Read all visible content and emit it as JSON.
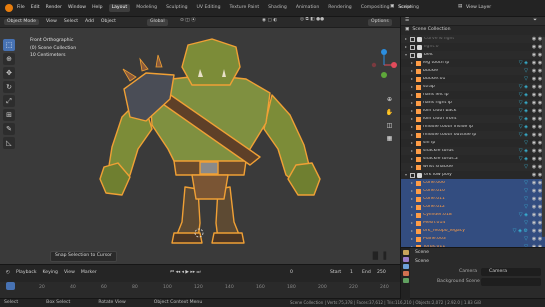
{
  "menu": {
    "items": [
      "File",
      "Edit",
      "Render",
      "Window",
      "Help"
    ],
    "workspaces": [
      "Layout",
      "Modeling",
      "Sculpting",
      "UV Editing",
      "Texture Paint",
      "Shading",
      "Animation",
      "Rendering",
      "Compositing",
      "Scripting"
    ],
    "active_workspace": "Layout",
    "scene_label": "Scene",
    "view_layer_label": "View Layer"
  },
  "viewport": {
    "mode": "Object Mode",
    "menus": [
      "View",
      "Select",
      "Add",
      "Object"
    ],
    "transform_orientation": "Global",
    "options_label": "Options",
    "overlay_lines": [
      "Front Orthographic",
      "(0) Scene Collection",
      "10 Centimeters"
    ],
    "snap_chip": "Snap Selection to Cursor",
    "gizmo_axes": [
      "X",
      "Y",
      "Z"
    ]
  },
  "timeline": {
    "menus": [
      "Playback",
      "Keying",
      "View",
      "Marker"
    ],
    "current_frame": "0",
    "start_label": "Start",
    "start_value": "1",
    "end_label": "End",
    "end_value": "250",
    "ruler_ticks": [
      "0",
      "20",
      "40",
      "60",
      "80",
      "100",
      "120",
      "140",
      "160",
      "180",
      "200",
      "220",
      "240"
    ]
  },
  "statusbar": {
    "select": "Select",
    "box_select": "Box Select",
    "rotate_view": "Rotate View",
    "context_menu": "Object Context Menu",
    "stats": "Scene Collection | Verts:75,378 | Faces:37,612 | Tris:116,210 | Objects:2,072 | 2.92.0 | 1.83 GiB"
  },
  "outliner": {
    "title": "Scene Collection",
    "rows": [
      {
        "name": "Curve & light",
        "level": 1,
        "expand": "▸",
        "type": "collection",
        "dim": true,
        "selected": false,
        "mods": "",
        "eye": "◉",
        "cam": "◉"
      },
      {
        "name": "light.0",
        "level": 1,
        "expand": "▸",
        "type": "collection",
        "dim": true,
        "selected": false,
        "mods": "",
        "eye": "◉",
        "cam": "◉"
      },
      {
        "name": "belt",
        "level": 1,
        "expand": "▾",
        "type": "collection",
        "dim": false,
        "selected": false,
        "mods": "",
        "eye": "◉",
        "cam": "◉"
      },
      {
        "name": "leg tooth lp",
        "level": 2,
        "expand": "▸",
        "type": "mesh",
        "dim": false,
        "selected": false,
        "mods": "▽ ◈",
        "eye": "◉",
        "cam": "◉"
      },
      {
        "name": "buckle",
        "level": 2,
        "expand": "▸",
        "type": "mesh",
        "dim": false,
        "selected": false,
        "mods": "▽",
        "eye": "◉",
        "cam": "◉"
      },
      {
        "name": "buckle.01",
        "level": 2,
        "expand": "▸",
        "type": "mesh",
        "dim": false,
        "selected": false,
        "mods": "▽",
        "eye": "◉",
        "cam": "◉"
      },
      {
        "name": "strap",
        "level": 2,
        "expand": "▸",
        "type": "mesh",
        "dim": false,
        "selected": false,
        "mods": "▽ ◈",
        "eye": "◉",
        "cam": "◉"
      },
      {
        "name": "hans left lp",
        "level": 2,
        "expand": "▸",
        "type": "mesh",
        "dim": false,
        "selected": false,
        "mods": "▽ ◈",
        "eye": "◉",
        "cam": "◉"
      },
      {
        "name": "hans right lp",
        "level": 2,
        "expand": "▸",
        "type": "mesh",
        "dim": false,
        "selected": false,
        "mods": "▽ ◈",
        "eye": "◉",
        "cam": "◉"
      },
      {
        "name": "loin cloth back",
        "level": 2,
        "expand": "▸",
        "type": "mesh",
        "dim": false,
        "selected": false,
        "mods": "▽ ◈",
        "eye": "◉",
        "cam": "◉"
      },
      {
        "name": "loin cloth front",
        "level": 2,
        "expand": "▸",
        "type": "mesh",
        "dim": false,
        "selected": false,
        "mods": "▽ ◈",
        "eye": "◉",
        "cam": "◉"
      },
      {
        "name": "middle tooth inside lp",
        "level": 2,
        "expand": "▸",
        "type": "mesh",
        "dim": false,
        "selected": false,
        "mods": "▽ ◈",
        "eye": "◉",
        "cam": "◉"
      },
      {
        "name": "middle tooth outside lp",
        "level": 2,
        "expand": "▸",
        "type": "mesh",
        "dim": false,
        "selected": false,
        "mods": "▽ ◈",
        "eye": "◉",
        "cam": "◉"
      },
      {
        "name": "sni lp",
        "level": 2,
        "expand": "▸",
        "type": "mesh",
        "dim": false,
        "selected": false,
        "mods": "▽",
        "eye": "◉",
        "cam": "◉"
      },
      {
        "name": "shackle torus",
        "level": 2,
        "expand": "▸",
        "type": "mesh",
        "dim": false,
        "selected": false,
        "mods": "▽ ◈",
        "eye": "◉",
        "cam": "◉"
      },
      {
        "name": "shackle torus.2",
        "level": 2,
        "expand": "▸",
        "type": "mesh",
        "dim": false,
        "selected": false,
        "mods": "▽ ◈",
        "eye": "◉",
        "cam": "◉"
      },
      {
        "name": "wrist shackle",
        "level": 2,
        "expand": "▸",
        "type": "mesh",
        "dim": false,
        "selected": false,
        "mods": "▽",
        "eye": "◉",
        "cam": "◉"
      },
      {
        "name": "ork low poly",
        "level": 1,
        "expand": "▾",
        "type": "collection",
        "dim": false,
        "selected": false,
        "mods": "",
        "eye": "◉",
        "cam": "◉"
      },
      {
        "name": "Cone.006",
        "level": 2,
        "expand": "▸",
        "type": "mesh",
        "dim": false,
        "selected": true,
        "mods": "▽",
        "eye": "◉",
        "cam": "◉"
      },
      {
        "name": "Cone.010",
        "level": 2,
        "expand": "▸",
        "type": "mesh",
        "dim": false,
        "selected": true,
        "mods": "▽",
        "eye": "◉",
        "cam": "◉"
      },
      {
        "name": "Cone.011",
        "level": 2,
        "expand": "▸",
        "type": "mesh",
        "dim": false,
        "selected": true,
        "mods": "▽",
        "eye": "◉",
        "cam": "◉"
      },
      {
        "name": "Cone.012",
        "level": 2,
        "expand": "▸",
        "type": "mesh",
        "dim": false,
        "selected": true,
        "mods": "▽",
        "eye": "◉",
        "cam": "◉"
      },
      {
        "name": "Cylinder.018",
        "level": 2,
        "expand": "▸",
        "type": "mesh",
        "dim": false,
        "selected": true,
        "mods": "▽ ◈",
        "eye": "◉",
        "cam": "◉"
      },
      {
        "name": "Mesh.014",
        "level": 2,
        "expand": "▸",
        "type": "mesh",
        "dim": false,
        "selected": true,
        "mods": "▽",
        "eye": "◉",
        "cam": "◉"
      },
      {
        "name": "ork_retopo_legacy",
        "level": 2,
        "expand": "▸",
        "type": "mesh",
        "dim": false,
        "selected": true,
        "mods": "▽ ◈ ⚙",
        "eye": "◉",
        "cam": "◉"
      },
      {
        "name": "Plane.003",
        "level": 2,
        "expand": "▸",
        "type": "mesh",
        "dim": false,
        "selected": true,
        "mods": "▽",
        "eye": "◉",
        "cam": "◉"
      },
      {
        "name": "Torus.011",
        "level": 2,
        "expand": "▸",
        "type": "mesh",
        "dim": false,
        "selected": true,
        "mods": "▽",
        "eye": "◉",
        "cam": "◉"
      }
    ]
  },
  "properties": {
    "header": "Scene",
    "panel": "Scene",
    "camera_label": "Camera",
    "camera_value": "Camera",
    "background_label": "Background Scene"
  },
  "colors": {
    "accent": "#4772b3",
    "selection_text": "#ff9d46",
    "brand": "#e87d0d",
    "skin": "#7c8c38",
    "outline": "#f0a035",
    "modifier": "#38b8d9"
  }
}
